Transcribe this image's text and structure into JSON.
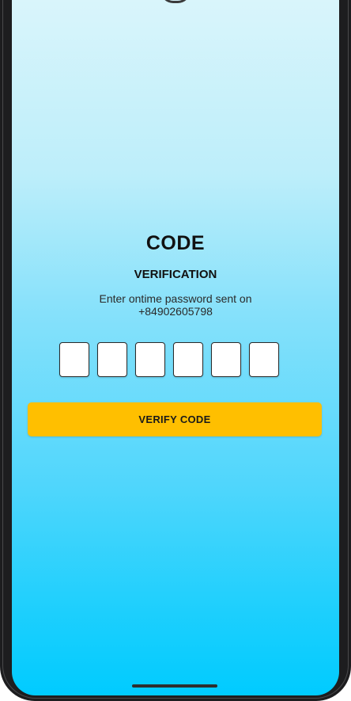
{
  "screen": {
    "title": "CODE",
    "subtitle": "VERIFICATION",
    "instruction": "Enter ontime password sent on",
    "phone_number": "+84902605798",
    "otp_digits": [
      "",
      "",
      "",
      "",
      "",
      ""
    ],
    "verify_button_label": "VERIFY CODE"
  },
  "colors": {
    "accent_button": "#ffbf00",
    "background_top": "#d9f5fb",
    "background_bottom": "#00cbff"
  }
}
